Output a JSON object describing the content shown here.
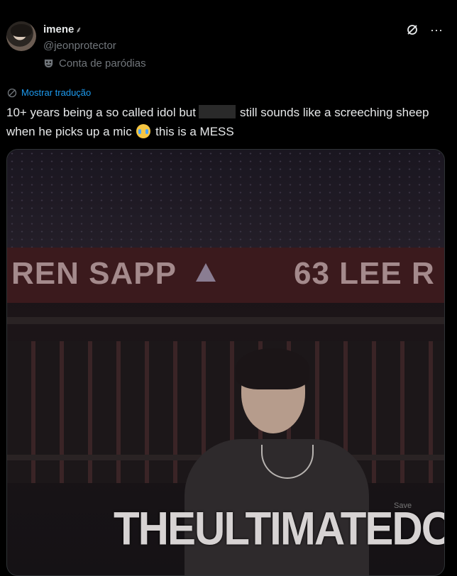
{
  "user": {
    "display_name": "imene",
    "name_decoration": "⸙",
    "handle": "@jeonprotector",
    "parody_label": "Conta de paródias"
  },
  "icons": {
    "grok": "grok-icon",
    "more": "more-icon",
    "parody": "mask-icon",
    "translate": "globe-icon"
  },
  "translate_label": "Mostrar tradução",
  "tweet": {
    "text_before": "10+ years being a so called idol but",
    "text_after": "still sounds like a screeching sheep when he picks up a mic",
    "text_end": "this is a MESS"
  },
  "media": {
    "banner_left": "REN SAPP",
    "banner_right": "63 LEE R",
    "watermark": "THEULTIMATEDODO",
    "small_watermark": "Save"
  },
  "colors": {
    "link": "#1d9bf0",
    "muted": "#71767b",
    "text": "#e7e9ea",
    "background": "#000000"
  }
}
